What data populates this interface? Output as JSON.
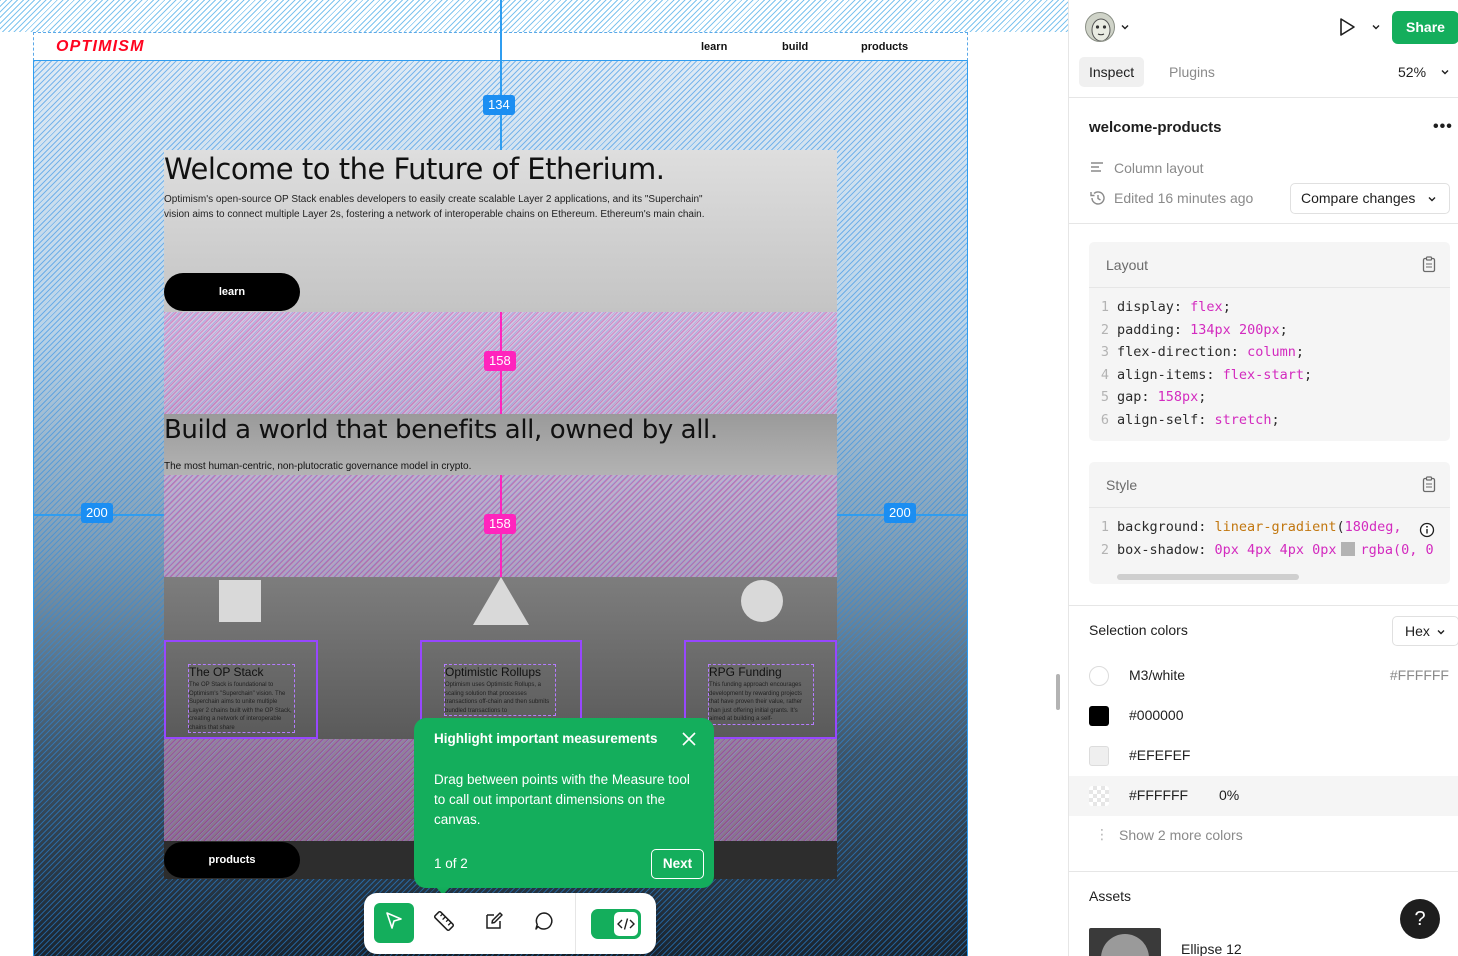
{
  "canvas": {
    "logo": "OPTIMISM",
    "nav": [
      "learn",
      "build",
      "products"
    ],
    "measurements": {
      "top_padding": "134",
      "gap_1": "158",
      "gap_2": "158",
      "left_padding": "200",
      "right_padding": "200"
    },
    "hero": {
      "title": "Welcome to the Future of Etherium.",
      "body": "Optimism's open-source OP Stack enables developers to easily create scalable Layer 2 applications, and its \"Superchain\" vision aims to connect multiple Layer 2s, fostering a network of interoperable chains on Ethereum. Ethereum's main chain.",
      "button": "learn"
    },
    "section2": {
      "title": "Build a world that benefits all, owned by all.",
      "body": "The most human-centric, non-plutocratic governance model in crypto."
    },
    "cards": [
      {
        "title": "The OP Stack",
        "text": "The OP Stack is foundational to Optimism's \"Superchain\" vision. The Superchain aims to unite multiple Layer 2 chains built with the OP Stack, creating a network of interoperable chains that share"
      },
      {
        "title": "Optimistic Rollups",
        "text": "Optimism uses Optimistic Rollups, a scaling solution that processes transactions off-chain and then submits bundled transactions to"
      },
      {
        "title": "RPG Funding",
        "text": "This funding approach encourages development by rewarding projects that have proven their value, rather than just offering initial grants. It's aimed at building a self-"
      }
    ],
    "footer_button": "products"
  },
  "tooltip": {
    "title": "Highlight important measurements",
    "body": "Drag between points with the Measure tool to call out important dimensions on the canvas.",
    "step": "1 of 2",
    "next_label": "Next"
  },
  "toolbar": {
    "tools": [
      "move-icon",
      "measure-icon",
      "annotate-icon",
      "comment-icon"
    ],
    "dev_mode_icon": "code-icon"
  },
  "panel": {
    "share_label": "Share",
    "tabs": [
      "Inspect",
      "Plugins"
    ],
    "zoom": "52%",
    "selection_name": "welcome-products",
    "layout_type": "Column layout",
    "edited": "Edited 16 minutes ago",
    "compare_label": "Compare changes",
    "layout_card": {
      "title": "Layout",
      "lines": [
        {
          "n": "1",
          "prop": "display",
          "val": "flex"
        },
        {
          "n": "2",
          "prop": "padding",
          "val": "134px 200px"
        },
        {
          "n": "3",
          "prop": "flex-direction",
          "val": "column"
        },
        {
          "n": "4",
          "prop": "align-items",
          "val": "flex-start"
        },
        {
          "n": "5",
          "prop": "gap",
          "val": "158px"
        },
        {
          "n": "6",
          "prop": "align-self",
          "val": "stretch"
        }
      ]
    },
    "style_card": {
      "title": "Style",
      "line1": {
        "n": "1",
        "prop": "background",
        "fn": "linear-gradient",
        "val": "180deg,"
      },
      "line2": {
        "n": "2",
        "prop": "box-shadow",
        "val": "0px 4px 4px 0px",
        "val2": "rgba(0, 0"
      }
    },
    "selection_colors_title": "Selection colors",
    "color_format": "Hex",
    "colors": [
      {
        "name": "M3/white",
        "hex": "#FFFFFF",
        "swatch": "#FFFFFF"
      },
      {
        "name": "#000000",
        "hex": "",
        "swatch": "#000000"
      },
      {
        "name": "#EFEFEF",
        "hex": "",
        "swatch": "#EFEFEF"
      },
      {
        "name": "#FFFFFF",
        "hex": "",
        "pct": "0%",
        "swatch": "transparent"
      }
    ],
    "show_more": "Show 2 more colors",
    "assets_title": "Assets",
    "asset_name": "Ellipse 12",
    "help": "?"
  },
  "colors": {
    "accent_green": "#14ae5c",
    "measure_blue": "#1b8ef2",
    "measure_pink": "#ff24bd",
    "brand_red": "#ff0420",
    "frame_purple": "#9747ff"
  }
}
